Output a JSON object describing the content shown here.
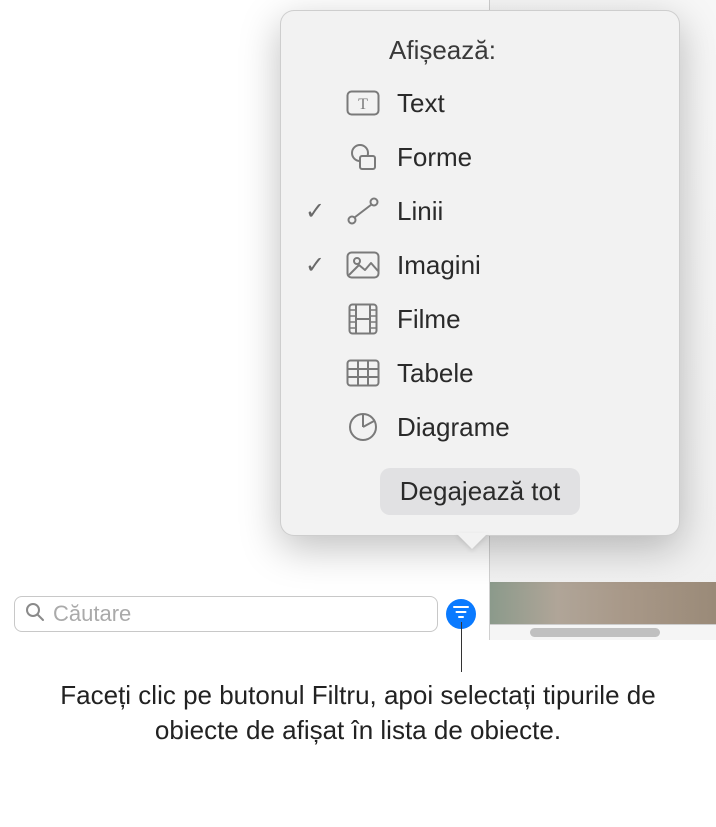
{
  "popover": {
    "header": "Afișează:",
    "items": [
      {
        "label": "Text",
        "icon": "text-box-icon",
        "checked": false
      },
      {
        "label": "Forme",
        "icon": "shapes-icon",
        "checked": false
      },
      {
        "label": "Linii",
        "icon": "lines-icon",
        "checked": true
      },
      {
        "label": "Imagini",
        "icon": "image-icon",
        "checked": true
      },
      {
        "label": "Filme",
        "icon": "film-icon",
        "checked": false
      },
      {
        "label": "Tabele",
        "icon": "table-icon",
        "checked": false
      },
      {
        "label": "Diagrame",
        "icon": "chart-icon",
        "checked": false
      }
    ],
    "clear_all": "Degajează tot"
  },
  "search": {
    "placeholder": "Căutare"
  },
  "callout": {
    "text": "Faceți clic pe butonul Filtru, apoi selectați tipurile de obiecte de afișat în lista de obiecte."
  },
  "colors": {
    "accent": "#0a7aff",
    "icon_stroke": "#7a7a7a"
  }
}
